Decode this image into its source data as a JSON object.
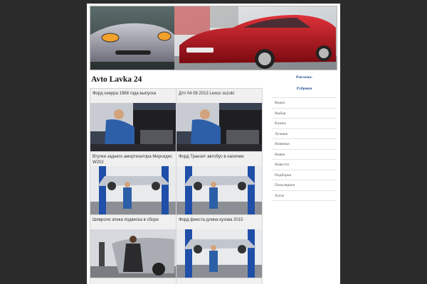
{
  "site": {
    "title": "Avto Lavka 24"
  },
  "sidebar": {
    "ads_heading": "Реклама:",
    "rubrics_heading": "Рубрики",
    "items": [
      "Видео",
      "Выбор",
      "Клипы",
      "Лучшее",
      "Новинки",
      "Новое",
      "Новости",
      "Подборки",
      "Популярное",
      "Хиты"
    ]
  },
  "posts": [
    {
      "caption": "Форд сиерра 1988 года выпуска",
      "image": "mechanic-engine-photo"
    },
    {
      "caption": "Дтп 04 08 2013 Lexus suzuki",
      "image": "mechanic-engine-photo"
    },
    {
      "caption": "Втулки заднего амортизатора Мерседес W202",
      "image": "car-lift-photo"
    },
    {
      "caption": "Форд Транзит автобус в наличии",
      "image": "car-lift-photo"
    },
    {
      "caption": "Шевроле эпика подвеска в сборе",
      "image": "car-polishing-photo"
    },
    {
      "caption": "Форд фиеста длина кузова 2015",
      "image": "car-lift-photo"
    },
    {
      "caption": "",
      "image": ""
    },
    {
      "caption": "",
      "image": ""
    }
  ]
}
